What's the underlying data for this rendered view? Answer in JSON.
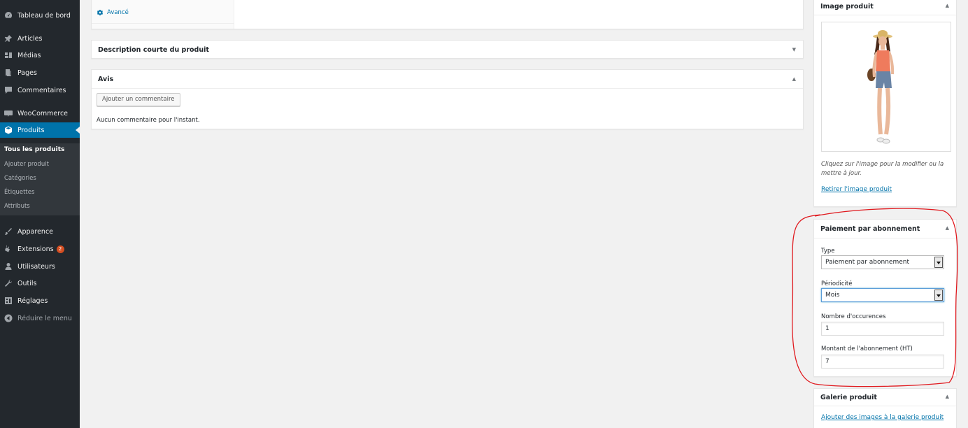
{
  "sidebar": {
    "items": [
      {
        "label": "Tableau de bord",
        "icon": "dashboard-icon"
      },
      {
        "label": "Articles",
        "icon": "pin-icon"
      },
      {
        "label": "Médias",
        "icon": "media-icon"
      },
      {
        "label": "Pages",
        "icon": "pages-icon"
      },
      {
        "label": "Commentaires",
        "icon": "comments-icon"
      },
      {
        "label": "WooCommerce",
        "icon": "woocommerce-icon"
      },
      {
        "label": "Produits",
        "icon": "products-icon"
      },
      {
        "label": "Apparence",
        "icon": "appearance-icon"
      },
      {
        "label": "Extensions",
        "icon": "plugins-icon",
        "badge": "2"
      },
      {
        "label": "Utilisateurs",
        "icon": "users-icon"
      },
      {
        "label": "Outils",
        "icon": "tools-icon"
      },
      {
        "label": "Réglages",
        "icon": "settings-icon"
      },
      {
        "label": "Réduire le menu",
        "icon": "collapse-icon"
      }
    ],
    "submenu": [
      "Tous les produits",
      "Ajouter produit",
      "Catégories",
      "Étiquettes",
      "Attributs"
    ]
  },
  "main": {
    "advanced_tab": "Avancé",
    "short_description_title": "Description courte du produit",
    "reviews_title": "Avis",
    "add_comment_button": "Ajouter un commentaire",
    "no_comments": "Aucun commentaire pour l'instant."
  },
  "side": {
    "image_title": "Image produit",
    "image_hint": "Cliquez sur l'image pour la modifier ou la mettre à jour.",
    "remove_image": "Retirer l'image produit",
    "subscription": {
      "title": "Paiement par abonnement",
      "type_label": "Type",
      "type_value": "Paiement par abonnement",
      "period_label": "Périodicité",
      "period_value": "Mois",
      "occurrences_label": "Nombre d'occurences",
      "occurrences_value": "1",
      "amount_label": "Montant de l'abonnement (HT)",
      "amount_value": "7"
    },
    "gallery_title": "Galerie produit",
    "gallery_link": "Ajouter des images à la galerie produit"
  },
  "colors": {
    "sidebar_bg": "#23282d",
    "accent": "#0073aa",
    "annotation": "#e0191e"
  }
}
